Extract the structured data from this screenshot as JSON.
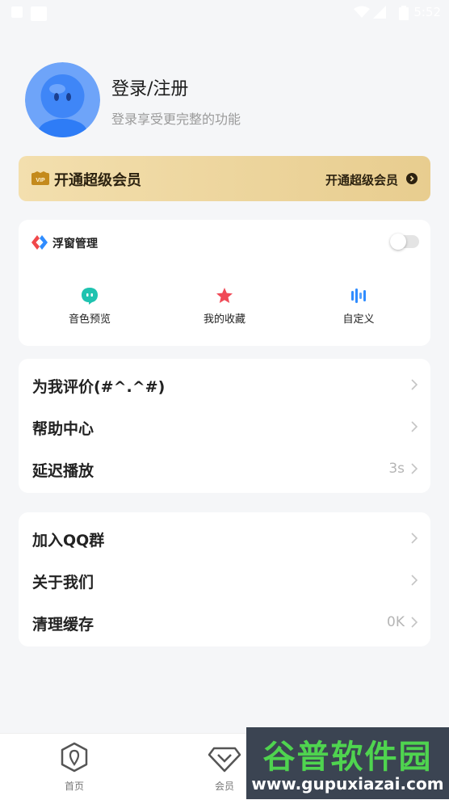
{
  "status_bar": {
    "time": "5:52"
  },
  "profile": {
    "title": "登录/注册",
    "subtitle": "登录享受更完整的功能"
  },
  "vip": {
    "label": "开通超级会员",
    "action": "开通超级会员",
    "icon": "vip-icon"
  },
  "float_window": {
    "title": "浮窗管理",
    "toggle_on": false,
    "features": [
      {
        "label": "音色预览",
        "icon": "chat-bubble-icon",
        "color": "#1fc3b0"
      },
      {
        "label": "我的收藏",
        "icon": "star-icon",
        "color": "#f04a57"
      },
      {
        "label": "自定义",
        "icon": "soundwave-icon",
        "color": "#2f8cff"
      }
    ]
  },
  "menu_group_1": [
    {
      "label": "为我评价(#^.^#)",
      "value": ""
    },
    {
      "label": "帮助中心",
      "value": ""
    },
    {
      "label": "延迟播放",
      "value": "3s"
    }
  ],
  "menu_group_2": [
    {
      "label": "加入QQ群",
      "value": ""
    },
    {
      "label": "关于我们",
      "value": ""
    },
    {
      "label": "清理缓存",
      "value": "0K"
    }
  ],
  "tabbar": {
    "tabs": [
      {
        "label": "首页",
        "icon": "home-icon"
      },
      {
        "label": "会员",
        "icon": "diamond-icon"
      }
    ]
  },
  "watermark": {
    "top": "谷普软件园",
    "bottom": "www.gupuxiazai.com"
  },
  "colors": {
    "background": "#f5f6f8",
    "vip_gold": "#ecd49b",
    "avatar_blue": "#3f86f7"
  }
}
